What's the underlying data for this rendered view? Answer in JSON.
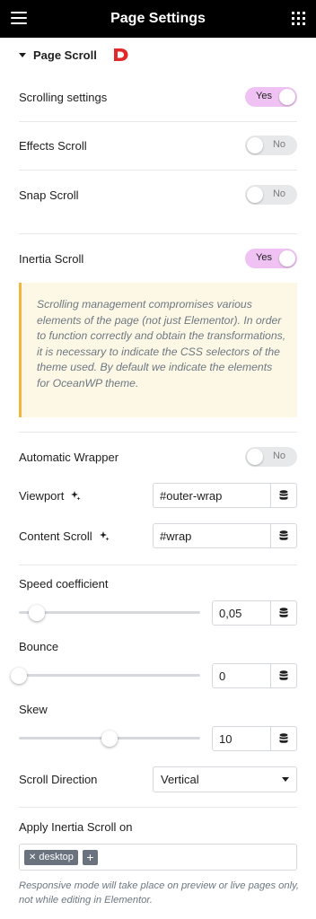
{
  "header": {
    "title": "Page Settings"
  },
  "section": {
    "title": "Page Scroll"
  },
  "toggles": {
    "scrolling_settings": {
      "label": "Scrolling settings",
      "state": "Yes"
    },
    "effects_scroll": {
      "label": "Effects Scroll",
      "state": "No"
    },
    "snap_scroll": {
      "label": "Snap Scroll",
      "state": "No"
    },
    "inertia_scroll": {
      "label": "Inertia Scroll",
      "state": "Yes"
    },
    "automatic_wrapper": {
      "label": "Automatic Wrapper",
      "state": "No"
    }
  },
  "notice": {
    "text": "Scrolling management compromises various elements of the page (not just Elementor). In order to function correctly and obtain the transformations, it is necessary to indicate the CSS selectors of the theme used. By default we indicate the elements for OceanWP theme."
  },
  "viewport": {
    "label": "Viewport",
    "value": "#outer-wrap"
  },
  "content_scroll": {
    "label": "Content Scroll",
    "value": "#wrap"
  },
  "sliders": {
    "speed_coefficient": {
      "label": "Speed coefficient",
      "value": "0,05",
      "fraction": 0.1
    },
    "bounce": {
      "label": "Bounce",
      "value": "0",
      "fraction": 0.0
    },
    "skew": {
      "label": "Skew",
      "value": "10",
      "fraction": 0.5
    }
  },
  "scroll_direction": {
    "label": "Scroll Direction",
    "value": "Vertical"
  },
  "apply_inertia": {
    "label": "Apply Inertia Scroll on",
    "tags": [
      "desktop"
    ],
    "note": "Responsive mode will take place on preview or live pages only, not while editing in Elementor."
  },
  "colors": {
    "accent_on": "#f0c2f3",
    "notice_border": "#f0b740",
    "notice_bg": "#fdf8e6",
    "header_bg": "#000000"
  }
}
